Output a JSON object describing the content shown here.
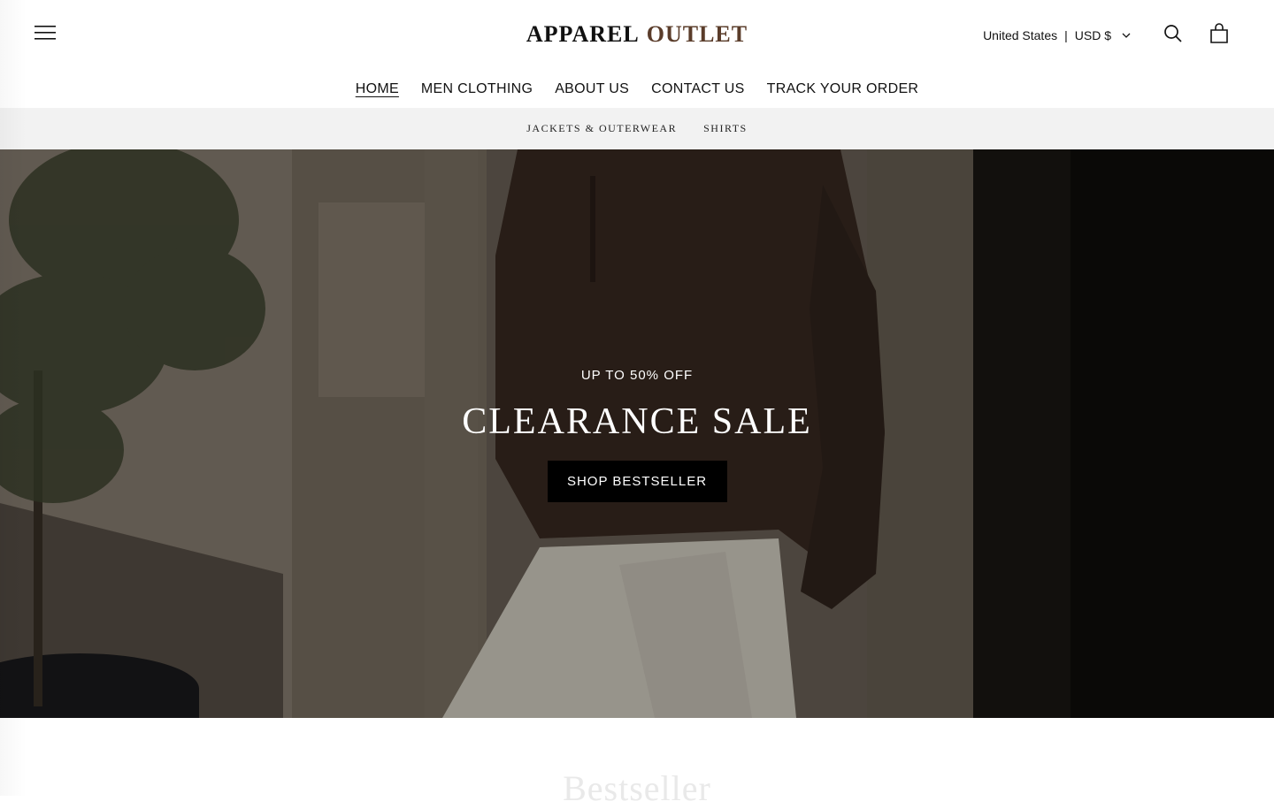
{
  "header": {
    "menu_icon": "hamburger-menu-icon",
    "logo": {
      "part1": "APPAREL",
      "part2": "OUTLET"
    },
    "locale": {
      "country": "United States",
      "separator": "|",
      "currency": "USD $"
    },
    "icons": {
      "search": "search-icon",
      "cart": "cart-icon",
      "chevron": "chevron-down-icon"
    }
  },
  "nav": {
    "items": [
      {
        "label": "HOME"
      },
      {
        "label": "MEN CLOTHING"
      },
      {
        "label": "ABOUT US"
      },
      {
        "label": "CONTACT US"
      },
      {
        "label": "TRACK YOUR ORDER"
      }
    ]
  },
  "subnav": {
    "items": [
      {
        "label": "JACKETS & OUTERWEAR"
      },
      {
        "label": "SHIRTS"
      }
    ]
  },
  "hero": {
    "subtitle": "UP TO 50% OFF",
    "title": "CLEARANCE SALE",
    "button_label": "SHOP BESTSELLER"
  },
  "section": {
    "title": "Bestseller"
  },
  "colors": {
    "brand_dark": "#111111",
    "brand_accent": "#5a3c2a",
    "subnav_bg": "#f2f2f2",
    "hero_button_bg": "#000000"
  }
}
